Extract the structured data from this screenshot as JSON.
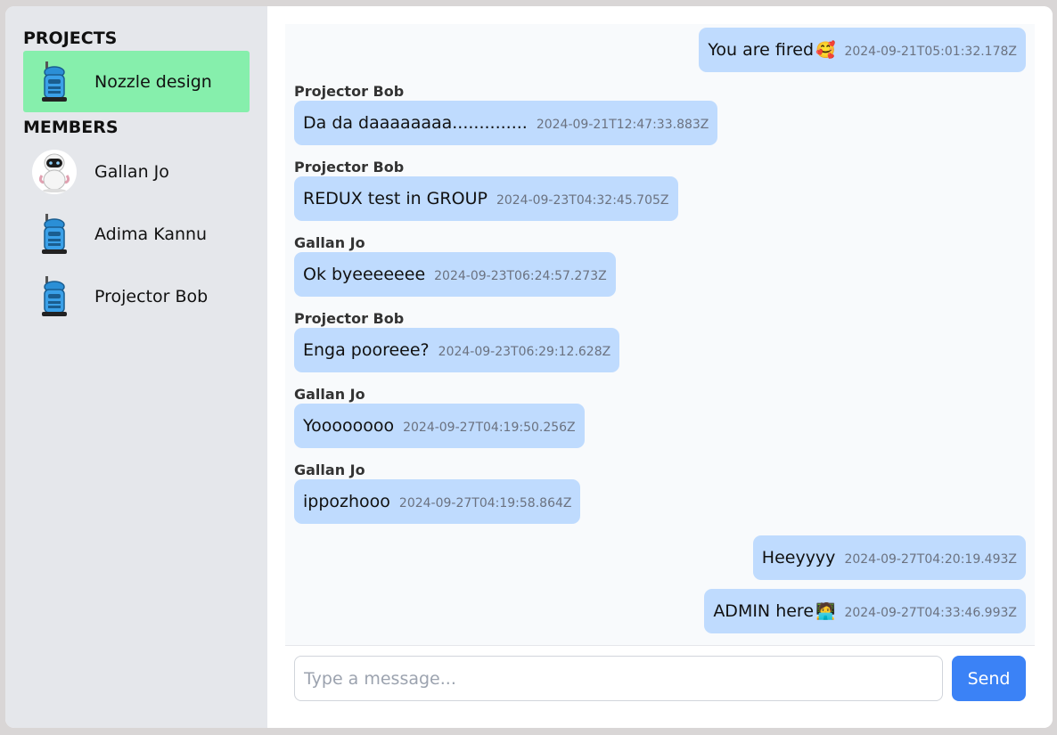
{
  "sidebar": {
    "projects_title": "PROJECTS",
    "members_title": "MEMBERS",
    "project": {
      "name": "Nozzle design"
    },
    "members": [
      {
        "name": "Gallan Jo",
        "avatar": "robot-white-avatar-icon"
      },
      {
        "name": "Adima Kannu",
        "avatar": "robot-blue-avatar-icon"
      },
      {
        "name": "Projector Bob",
        "avatar": "robot-blue-avatar-icon"
      }
    ]
  },
  "messages": [
    {
      "own": true,
      "sender": "",
      "text": "You are fired",
      "emoji": "🥰",
      "time": "2024-09-21T05:01:32.178Z"
    },
    {
      "own": false,
      "sender": "Projector Bob",
      "text": "Da da daaaaaaaa..............",
      "time": "2024-09-21T12:47:33.883Z"
    },
    {
      "own": false,
      "sender": "Projector Bob",
      "text": "REDUX test in GROUP",
      "time": "2024-09-23T04:32:45.705Z"
    },
    {
      "own": false,
      "sender": "Gallan Jo",
      "text": "Ok byeeeeeee",
      "time": "2024-09-23T06:24:57.273Z"
    },
    {
      "own": false,
      "sender": "Projector Bob",
      "text": "Enga pooreee?",
      "time": "2024-09-23T06:29:12.628Z"
    },
    {
      "own": false,
      "sender": "Gallan Jo",
      "text": "Yoooooooo",
      "time": "2024-09-27T04:19:50.256Z"
    },
    {
      "own": false,
      "sender": "Gallan Jo",
      "text": "ippozhooo",
      "time": "2024-09-27T04:19:58.864Z"
    },
    {
      "own": true,
      "sender": "",
      "text": "Heeyyyy",
      "emoji": "",
      "time": "2024-09-27T04:20:19.493Z"
    },
    {
      "own": true,
      "sender": "",
      "text": "ADMIN here",
      "emoji": "🧑‍💻",
      "time": "2024-09-27T04:33:46.993Z"
    }
  ],
  "composer": {
    "placeholder": "Type a message...",
    "value": "",
    "send_label": "Send"
  },
  "colors": {
    "sidebar_bg": "#e5e7eb",
    "active_project": "#86efac",
    "bubble": "#bfdbfe",
    "send_button": "#3b82f6"
  }
}
